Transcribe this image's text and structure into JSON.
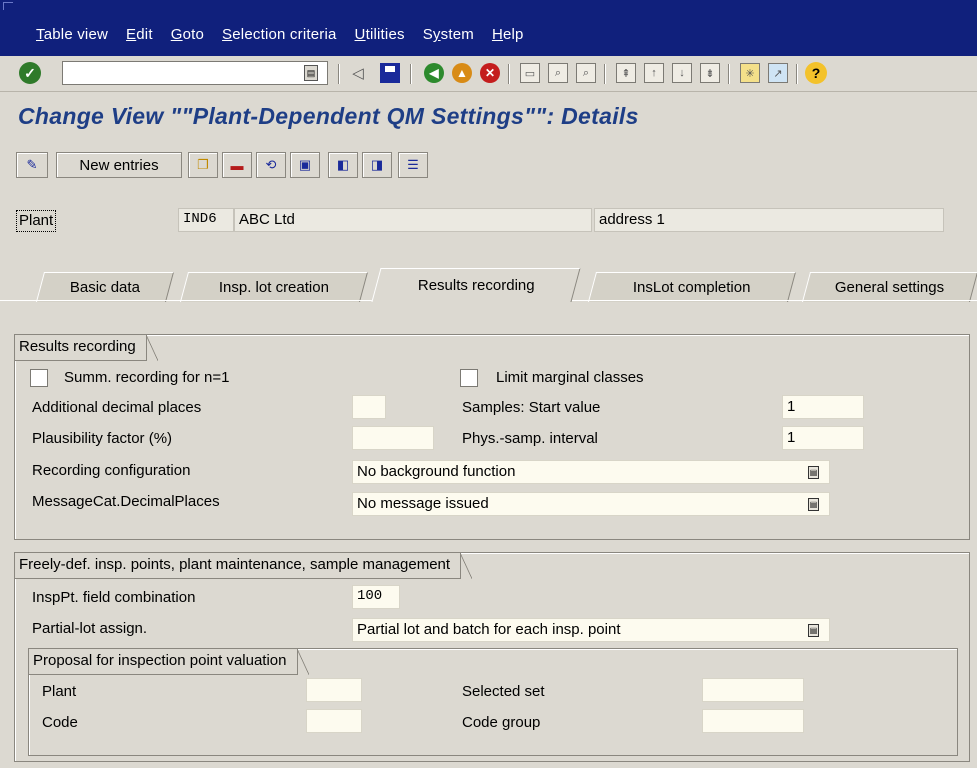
{
  "menu": {
    "items": [
      {
        "u": "T",
        "rest": "able view"
      },
      {
        "u": "E",
        "rest": "dit"
      },
      {
        "u": "G",
        "rest": "oto"
      },
      {
        "u": "S",
        "rest": "election criteria"
      },
      {
        "u": "U",
        "rest": "tilities"
      },
      {
        "u": "",
        "rest": "System",
        "mid_u": "y"
      },
      {
        "u": "H",
        "rest": "elp"
      }
    ]
  },
  "page": {
    "title": "Change View \"\"Plant-Dependent QM Settings\"\": Details"
  },
  "apptoolbar": {
    "new_entries_label": "New entries"
  },
  "header": {
    "plant_label": "Plant",
    "plant_code": "IND6",
    "plant_name": "ABC Ltd",
    "address": "address 1"
  },
  "tabs": [
    {
      "label": "Basic data",
      "active": false
    },
    {
      "label": "Insp. lot creation",
      "active": false
    },
    {
      "label": "Results recording",
      "active": true
    },
    {
      "label": "InsLot completion",
      "active": false
    },
    {
      "label": "General settings",
      "active": false
    }
  ],
  "results_recording": {
    "group_title": "Results recording",
    "summ_recording_label": "Summ. recording for n=1",
    "summ_recording_checked": false,
    "limit_marginal_label": "Limit marginal classes",
    "limit_marginal_checked": false,
    "additional_decimal_label": "Additional decimal places",
    "additional_decimal_value": "",
    "samples_start_label": "Samples: Start value",
    "samples_start_value": "1",
    "plausibility_label": "Plausibility factor (%)",
    "plausibility_value": "",
    "phys_samp_label": "Phys.-samp. interval",
    "phys_samp_value": "1",
    "recording_config_label": "Recording configuration",
    "recording_config_value": "No background function",
    "messagecat_label": "MessageCat.DecimalPlaces",
    "messagecat_value": "No message issued"
  },
  "freely_def": {
    "group_title": "Freely-def. insp. points, plant maintenance, sample management",
    "insppt_label": "InspPt. field combination",
    "insppt_value": "100",
    "partial_lot_label": "Partial-lot assign.",
    "partial_lot_value": "Partial lot and batch for each insp. point"
  },
  "proposal": {
    "group_title": "Proposal for inspection point valuation",
    "plant_label": "Plant",
    "plant_value": "",
    "selected_set_label": "Selected set",
    "selected_set_value": "",
    "code_label": "Code",
    "code_value": "",
    "code_group_label": "Code group",
    "code_group_value": ""
  }
}
